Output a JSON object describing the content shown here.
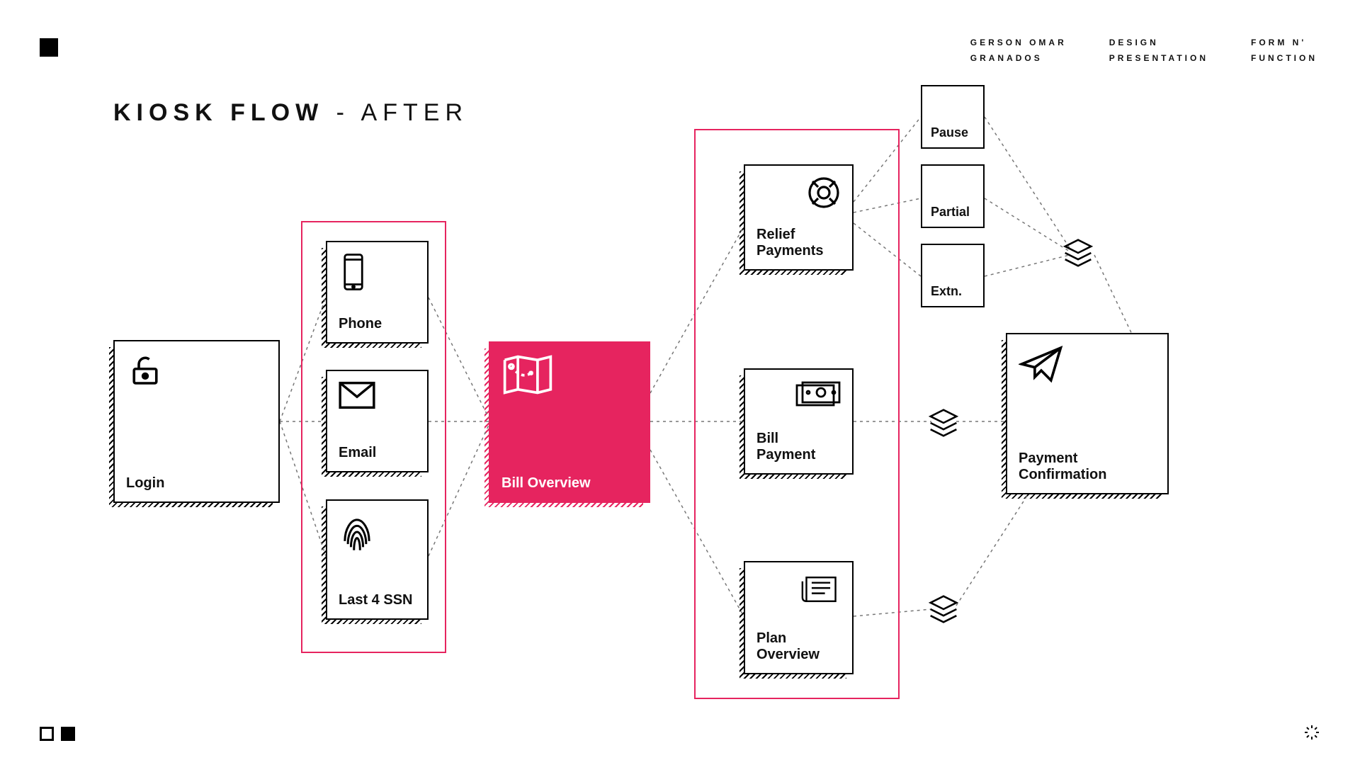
{
  "header": {
    "meta_author": "GERSON OMAR\nGRANADOS",
    "meta_center": "DESIGN\nPRESENTATION",
    "meta_right": "FORM N'\nFUNCTION"
  },
  "title": {
    "bold": "KIOSK FLOW",
    "separator": " - ",
    "light": "AFTER"
  },
  "colors": {
    "accent": "#e6245f"
  },
  "nodes": {
    "login": "Login",
    "phone": "Phone",
    "email": "Email",
    "ssn": "Last 4 SSN",
    "bill_overview": "Bill Overview",
    "relief": "Relief\nPayments",
    "bill_payment": "Bill\nPayment",
    "plan_overview": "Plan\nOverview",
    "confirmation": "Payment\nConfirmation",
    "pause": "Pause",
    "partial": "Partial",
    "extn": "Extn."
  },
  "icons": {
    "lock": "lock-open-icon",
    "phone": "smartphone-icon",
    "email": "envelope-icon",
    "fingerprint": "fingerprint-icon",
    "map": "map-icon",
    "lifering": "life-ring-icon",
    "cash": "cash-icon",
    "blueprint": "blueprint-icon",
    "send": "paper-plane-icon",
    "layers": "layers-icon"
  }
}
